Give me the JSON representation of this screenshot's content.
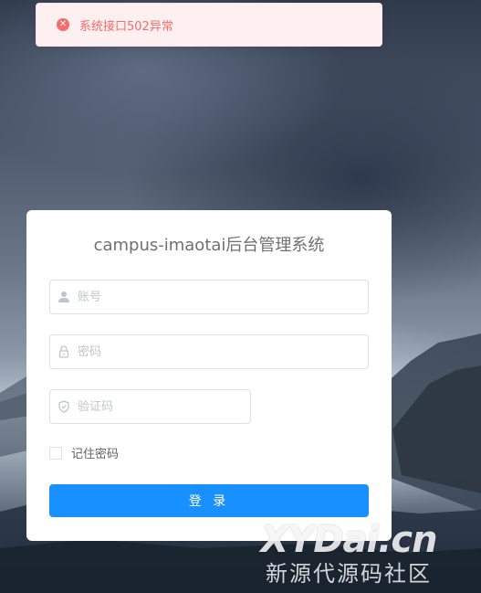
{
  "toast": {
    "icon": "error-circle-icon",
    "message": "系统接口502异常",
    "color": "#f56c6c"
  },
  "login": {
    "title": "campus-imaotai后台管理系统",
    "username": {
      "placeholder": "账号",
      "value": "",
      "icon": "user-icon"
    },
    "password": {
      "placeholder": "密码",
      "value": "",
      "icon": "lock-icon"
    },
    "captcha": {
      "placeholder": "验证码",
      "value": "",
      "icon": "shield-icon"
    },
    "remember_label": "记住密码",
    "remember_checked": false,
    "submit_label": "登 录",
    "accent": "#1890ff"
  },
  "watermark": {
    "brand": "XYDai.cn",
    "subtitle": "新源代源码社区"
  }
}
